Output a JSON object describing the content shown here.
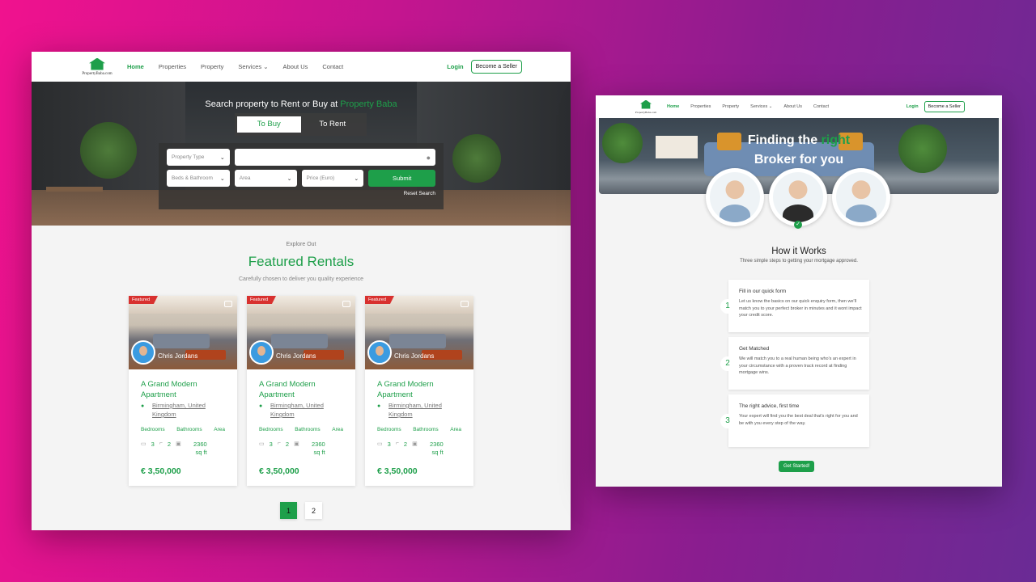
{
  "left": {
    "nav": {
      "logo_text": "PropertyBaba.com",
      "links": [
        "Home",
        "Properties",
        "Property",
        "Services ⌄",
        "About Us",
        "Contact"
      ],
      "login": "Login",
      "become_seller": "Become a Seller"
    },
    "hero": {
      "title_prefix": "Search property to Rent or Buy at ",
      "title_brand": "Property Baba",
      "tab_buy": "To Buy",
      "tab_rent": "To Rent",
      "property_type": "Property Type",
      "location_placeholder": "",
      "beds_bath": "Beds & Bathroom",
      "area": "Area",
      "price": "Price (Euro)",
      "submit": "Submit",
      "reset": "Reset Search"
    },
    "featured": {
      "explore": "Explore Out",
      "title": "Featured Rentals",
      "subtitle": "Carefully chosen to deliver you quality experience"
    },
    "cards": [
      {
        "badge": "Featured",
        "agent": "Chris Jordans",
        "title": "A Grand Modern Apartment",
        "location": "Birmingham, United Kingdom",
        "labels": [
          "Bedrooms",
          "Bathrooms",
          "Area"
        ],
        "bedrooms": "3",
        "bathrooms": "2",
        "area": "2360 sq ft",
        "price": "€ 3,50,000"
      },
      {
        "badge": "Featured",
        "agent": "Chris Jordans",
        "title": "A Grand Modern Apartment",
        "location": "Birmingham, United Kingdom",
        "labels": [
          "Bedrooms",
          "Bathrooms",
          "Area"
        ],
        "bedrooms": "3",
        "bathrooms": "2",
        "area": "2360 sq ft",
        "price": "€ 3,50,000"
      },
      {
        "badge": "Featured",
        "agent": "Chris Jordans",
        "title": "A Grand Modern Apartment",
        "location": "Birmingham, United Kingdom",
        "labels": [
          "Bedrooms",
          "Bathrooms",
          "Area"
        ],
        "bedrooms": "3",
        "bathrooms": "2",
        "area": "2360 sq ft",
        "price": "€ 3,50,000"
      }
    ],
    "pagination": [
      "1",
      "2"
    ]
  },
  "right": {
    "nav": {
      "logo_text": "PropertyBaba.com",
      "links": [
        "Home",
        "Properties",
        "Property",
        "Services ⌄",
        "About Us",
        "Contact"
      ],
      "login": "Login",
      "become_seller": "Become a Seller"
    },
    "hero": {
      "line1_prefix": "Finding the ",
      "line1_accent": "right",
      "line2": "Broker for you"
    },
    "how": {
      "title": "How it Works",
      "subtitle": "Three simple steps to getting your mortgage approved."
    },
    "steps": [
      {
        "num": "1",
        "title": "Fill in our quick form",
        "text": "Let us know the basics on our quick enquiry form, then we'll match you to your perfect broker in minutes and it wont impact your credit score."
      },
      {
        "num": "2",
        "title": "Get Matched",
        "text": "We will match you to a real human being who's an expert in your circumstance with a proven track record at finding mortgage wins."
      },
      {
        "num": "3",
        "title": "The right advice, first time",
        "text": "Your expert will find you the best deal that's right for you and be with you every step of the way."
      }
    ],
    "cta": "Get Started!"
  },
  "colors": {
    "accent": "#1e9f4a",
    "badge": "#d8312f",
    "background_start": "#f0128e",
    "background_end": "#6a2b95"
  }
}
